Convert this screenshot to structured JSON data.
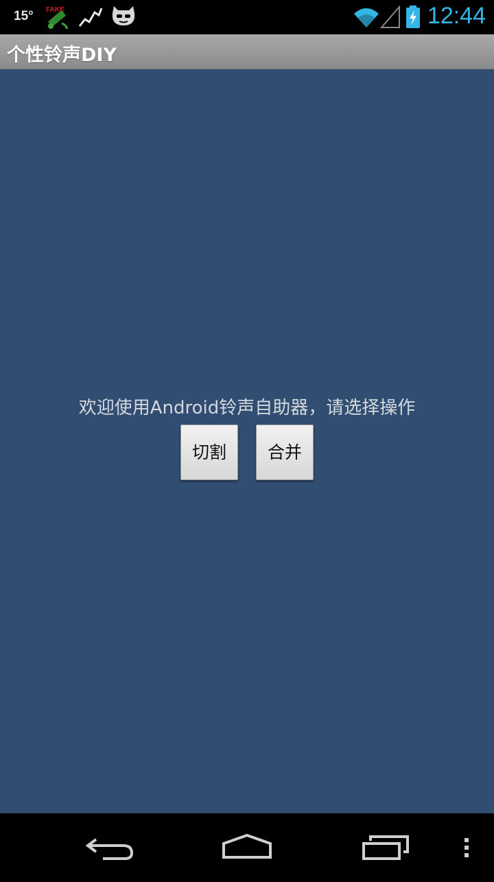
{
  "status_bar": {
    "temperature": "15°",
    "clock": "12:44",
    "icons": [
      "fake-gps-icon",
      "activity-graph-icon",
      "cyanogen-mascot-icon",
      "wifi-icon",
      "signal-icon",
      "battery-charging-icon"
    ],
    "clock_color": "#33b5e5"
  },
  "action_bar": {
    "title": "个性铃声DIY"
  },
  "main": {
    "welcome_text": "欢迎使用Android铃声自助器，请选择操作",
    "buttons": {
      "cut_label": "切割",
      "merge_label": "合并"
    },
    "background_color": "#314e72"
  },
  "nav_bar": {
    "buttons": [
      "back-icon",
      "home-icon",
      "recent-apps-icon",
      "menu-icon"
    ]
  }
}
